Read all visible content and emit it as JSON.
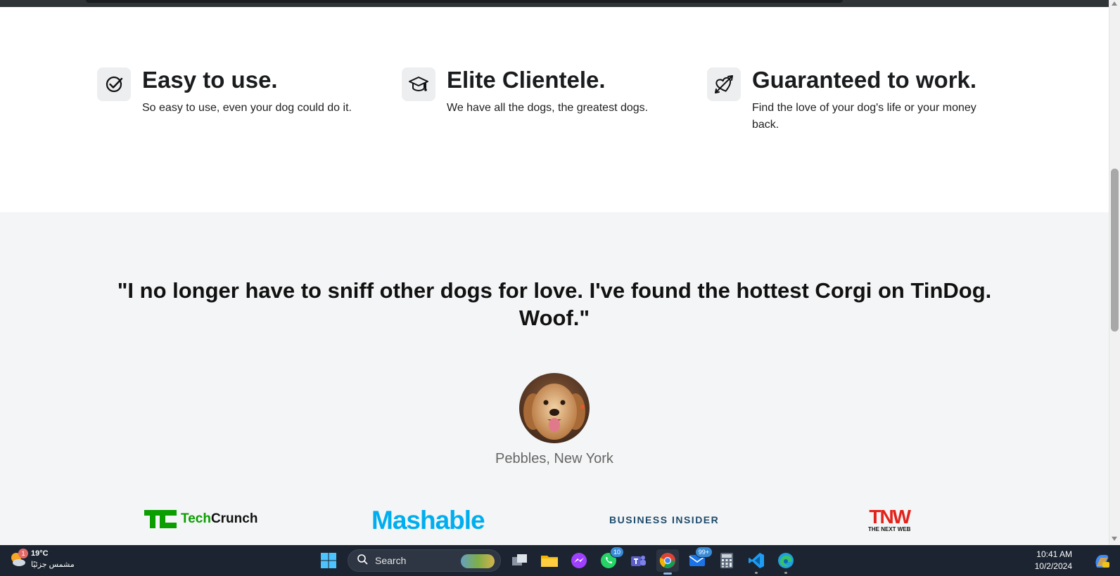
{
  "features": [
    {
      "title": "Easy to use.",
      "text": "So easy to use, even your dog could do it.",
      "icon": "check-circle-icon"
    },
    {
      "title": "Elite Clientele.",
      "text": "We have all the dogs, the greatest dogs.",
      "icon": "graduation-cap-icon"
    },
    {
      "title": "Guaranteed to work.",
      "text": "Find the love of your dog's life or your money back.",
      "icon": "heart-arrow-icon"
    }
  ],
  "testimonial": {
    "quote": "\"I no longer have to sniff other dogs for love. I've found the hottest Corgi on TinDog. Woof.\"",
    "author": "Pebbles, New York"
  },
  "press": {
    "techcrunch_a": "Tech",
    "techcrunch_b": "Crunch",
    "mashable": "Mashable",
    "business_insider": "BUSINESS INSIDER",
    "tnw_big": "TNW",
    "tnw_small": "THE NEXT WEB"
  },
  "taskbar": {
    "weather_badge": "1",
    "temperature": "19°C",
    "weather_desc": "مشمس جزئيًا",
    "search_label": "Search",
    "whatsapp_count": "10",
    "mail_count": "99+",
    "time": "10:41 AM",
    "date": "10/2/2024"
  },
  "colors": {
    "techcrunch_green": "#0a9e01",
    "mashable_blue": "#00aeef",
    "bi_navy": "#1d4a6b",
    "tnw_red": "#e3231b",
    "taskbar_bg": "#1c2431"
  }
}
